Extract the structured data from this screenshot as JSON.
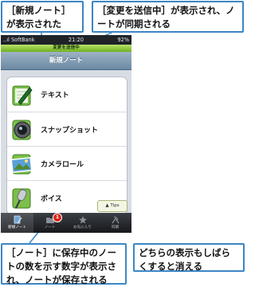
{
  "callouts": {
    "top_left": "［新規ノート］が表示された",
    "top_right": "［変更を送信中］が表示され、ノートが同期される",
    "bottom_left": "［ノート］に保存中のノートの数を示す数字が表示され、ノートが保存される",
    "bottom_right": "どちらの表示もしばらくすると消える"
  },
  "status_bar": {
    "carrier": "..ıl SoftBank",
    "time": "21:20",
    "battery": "92%"
  },
  "sync_banner": "変更を送信中",
  "nav_title": "新規ノート",
  "list_items": [
    {
      "label": "テキスト",
      "icon": "pencil-note-icon"
    },
    {
      "label": "スナップショット",
      "icon": "camera-lens-icon"
    },
    {
      "label": "カメラロール",
      "icon": "photo-roll-icon"
    },
    {
      "label": "ボイス",
      "icon": "microphone-icon"
    }
  ],
  "tips_button": "▲ Tips",
  "tab_bar": {
    "tabs": [
      {
        "label": "新規ノート",
        "icon": "new-note-icon"
      },
      {
        "label": "ノート",
        "icon": "notes-folder-icon"
      },
      {
        "label": "お気に入り",
        "icon": "star-icon"
      },
      {
        "label": "同期",
        "icon": "sync-satellite-icon"
      }
    ],
    "notes_badge": "1"
  },
  "colors": {
    "callout_border": "#3b86c4",
    "sync_green": "#8cc63f",
    "nav_blue": "#7f99b0",
    "badge_red": "#d9261c"
  }
}
